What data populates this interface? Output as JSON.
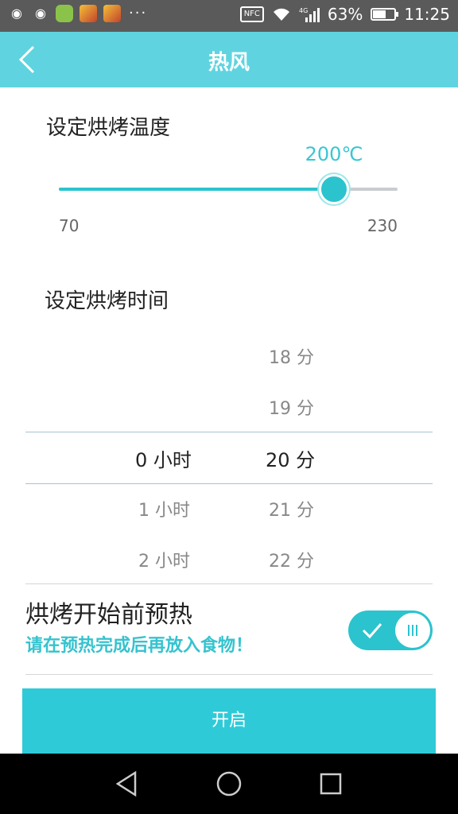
{
  "status_bar": {
    "nfc": "NFC",
    "network": "4G",
    "battery": "63%",
    "battery_level": 0.63,
    "time": "11:25",
    "icons": [
      "weibo-icon",
      "weibo-icon",
      "android-icon",
      "app-icon",
      "app-icon",
      "more-icon",
      "nfc-icon",
      "wifi-icon",
      "signal-icon",
      "battery-icon"
    ]
  },
  "header": {
    "title": "热风",
    "back_icon": "chevron-left-icon"
  },
  "temperature": {
    "title": "设定烘烤温度",
    "value": "200℃",
    "min": "70",
    "max": "230",
    "current": 200,
    "range": [
      70,
      230
    ]
  },
  "time": {
    "title": "设定烘烤时间",
    "hours": [
      {
        "label": "0 小时",
        "selected": true
      },
      {
        "label": "1 小时",
        "selected": false
      },
      {
        "label": "2 小时",
        "selected": false
      }
    ],
    "minutes": [
      {
        "label": "18 分",
        "selected": false
      },
      {
        "label": "19 分",
        "selected": false
      },
      {
        "label": "20 分",
        "selected": true
      },
      {
        "label": "21 分",
        "selected": false
      },
      {
        "label": "22 分",
        "selected": false
      }
    ]
  },
  "preheat": {
    "title": "烘烤开始前预热",
    "note": "请在预热完成后再放入食物！",
    "enabled": true
  },
  "start_button": {
    "label": "开启"
  },
  "colors": {
    "accent": "#2bc3ce",
    "header": "#5fd4e0"
  }
}
